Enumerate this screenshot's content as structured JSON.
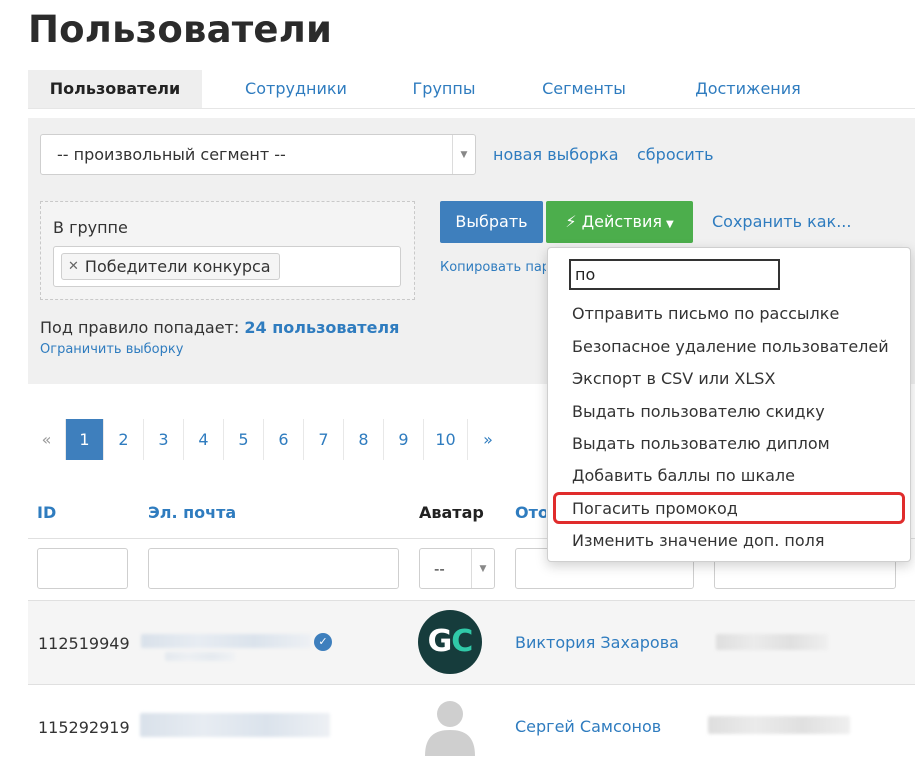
{
  "page": {
    "title": "Пользователи"
  },
  "tabs": [
    {
      "label": "Пользователи",
      "active": true
    },
    {
      "label": "Сотрудники",
      "active": false
    },
    {
      "label": "Группы",
      "active": false
    },
    {
      "label": "Сегменты",
      "active": false
    },
    {
      "label": "Достижения",
      "active": false
    }
  ],
  "filter": {
    "segment_value": "-- произвольный сегмент --",
    "new_selection": "новая выборка",
    "reset": "сбросить",
    "group_label": "В группе",
    "group_tag": "Победители конкурса",
    "rule_prefix": "Под правило попадает:",
    "rule_count": "24 пользователя",
    "limit_link": "Ограничить выборку"
  },
  "actions": {
    "select_button": "Выбрать",
    "actions_button": "Действия",
    "save_as": "Сохранить как...",
    "copy_link": "Копировать параметры"
  },
  "dropdown": {
    "search_value": "по",
    "items": [
      "Отправить письмо по рассылке",
      "Безопасное удаление пользователей",
      "Экспорт в CSV или XLSX",
      "Выдать пользователю скидку",
      "Выдать пользователю диплом",
      "Добавить баллы по шкале",
      "Погасить промокод",
      "Изменить значение доп. поля"
    ],
    "highlighted_index": 6
  },
  "pagination": {
    "prev": "«",
    "pages": [
      "1",
      "2",
      "3",
      "4",
      "5",
      "6",
      "7",
      "8",
      "9",
      "10"
    ],
    "next": "»",
    "current": "1"
  },
  "table": {
    "headers": {
      "id": "ID",
      "email": "Эл. почта",
      "avatar": "Аватар",
      "name": "Отображаемое имя"
    },
    "avatar_filter_value": "--",
    "rows": [
      {
        "id": "112519949",
        "avatar_initials_1": "G",
        "avatar_initials_2": "C",
        "name": "Виктория Захарова",
        "verified": true
      },
      {
        "id": "115292919",
        "name": "Сергей Самсонов",
        "verified": false
      }
    ]
  },
  "colors": {
    "accent": "#2f7cbf",
    "primary_button": "#3e7fbd",
    "success_button": "#4cae4c",
    "highlight": "#e02c2c"
  }
}
